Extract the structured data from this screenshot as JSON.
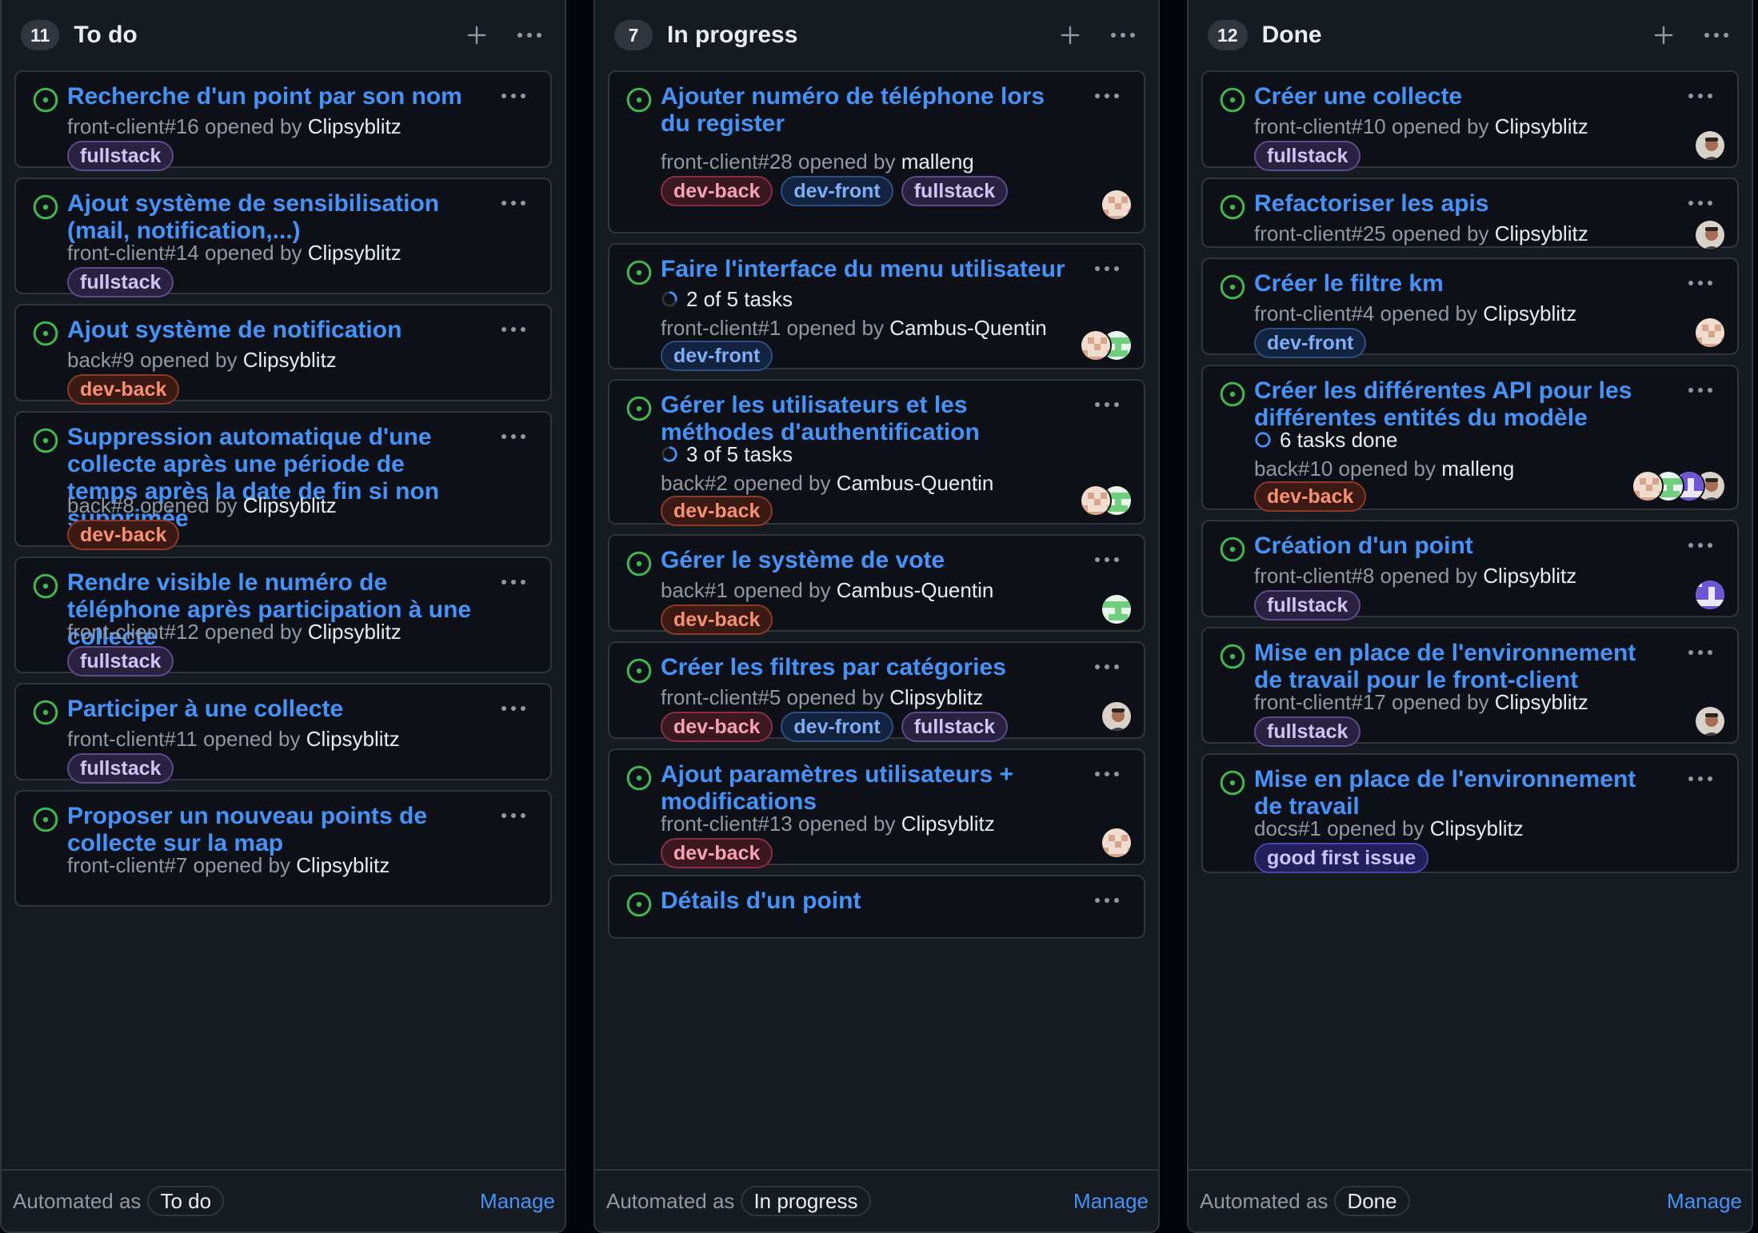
{
  "columns": [
    {
      "count": "11",
      "title": "To do",
      "footer": {
        "automated_label": "Automated as",
        "status": "To do",
        "manage": "Manage"
      },
      "cards": [
        {
          "title": "Recherche d'un point par son nom",
          "ref": "front-client#16",
          "opened_by": "opened by",
          "author": "Clipsyblitz",
          "labels": [
            {
              "text": "fullstack",
              "kind": "fullstack"
            }
          ],
          "avatars": []
        },
        {
          "title": "Ajout système de sensibilisation (mail, notification,...)",
          "ref": "front-client#14",
          "opened_by": "opened by",
          "author": "Clipsyblitz",
          "labels": [
            {
              "text": "fullstack",
              "kind": "fullstack"
            }
          ],
          "avatars": []
        },
        {
          "title": "Ajout système de notification",
          "ref": "back#9",
          "opened_by": "opened by",
          "author": "Clipsyblitz",
          "labels": [
            {
              "text": "dev-back",
              "kind": "devback"
            }
          ],
          "avatars": []
        },
        {
          "title": "Suppression automatique d'une collecte après une période de temps après la date de fin si non supprimée",
          "ref": "back#8",
          "opened_by": "opened by",
          "author": "Clipsyblitz",
          "labels": [
            {
              "text": "dev-back",
              "kind": "devback"
            }
          ],
          "avatars": []
        },
        {
          "title": "Rendre visible le numéro de téléphone après participation à une collecte",
          "ref": "front-client#12",
          "opened_by": "opened by",
          "author": "Clipsyblitz",
          "labels": [
            {
              "text": "fullstack",
              "kind": "fullstack"
            }
          ],
          "avatars": []
        },
        {
          "title": "Participer à une collecte",
          "ref": "front-client#11",
          "opened_by": "opened by",
          "author": "Clipsyblitz",
          "labels": [
            {
              "text": "fullstack",
              "kind": "fullstack"
            }
          ],
          "avatars": []
        },
        {
          "title": "Proposer un nouveau points de collecte sur la map",
          "ref": "front-client#7",
          "opened_by": "opened by",
          "author": "Clipsyblitz",
          "labels": [],
          "avatars": []
        }
      ]
    },
    {
      "count": "7",
      "title": "In progress",
      "footer": {
        "automated_label": "Automated as",
        "status": "In progress",
        "manage": "Manage"
      },
      "cards": [
        {
          "title": "Ajouter numéro de téléphone lors du register",
          "ref": "front-client#28",
          "opened_by": "opened by",
          "author": "malleng",
          "labels": [
            {
              "text": "dev-back",
              "kind": "devback-alt"
            },
            {
              "text": "dev-front",
              "kind": "devfront"
            },
            {
              "text": "fullstack",
              "kind": "fullstack"
            }
          ],
          "avatars": [
            "identicon-beige"
          ]
        },
        {
          "title": "Faire l'interface du menu utilisateur",
          "tasks": "2 of 5 tasks",
          "ref": "front-client#1",
          "opened_by": "opened by",
          "author": "Cambus-Quentin",
          "labels": [
            {
              "text": "dev-front",
              "kind": "devfront"
            }
          ],
          "avatars": [
            "identicon-beige",
            "identicon-green"
          ]
        },
        {
          "title": "Gérer les utilisateurs et les méthodes d'authentification",
          "tasks": "3 of 5 tasks",
          "ref": "back#2",
          "opened_by": "opened by",
          "author": "Cambus-Quentin",
          "labels": [
            {
              "text": "dev-back",
              "kind": "devback"
            }
          ],
          "avatars": [
            "identicon-beige",
            "identicon-green"
          ]
        },
        {
          "title": "Gérer le système de vote",
          "ref": "back#1",
          "opened_by": "opened by",
          "author": "Cambus-Quentin",
          "labels": [
            {
              "text": "dev-back",
              "kind": "devback"
            }
          ],
          "avatars": [
            "identicon-green"
          ]
        },
        {
          "title": "Créer les filtres par catégories",
          "ref": "front-client#5",
          "opened_by": "opened by",
          "author": "Clipsyblitz",
          "labels": [
            {
              "text": "dev-back",
              "kind": "devback-alt"
            },
            {
              "text": "dev-front",
              "kind": "devfront"
            },
            {
              "text": "fullstack",
              "kind": "fullstack"
            }
          ],
          "avatars": [
            "photo"
          ]
        },
        {
          "title": "Ajout paramètres utilisateurs + modifications",
          "ref": "front-client#13",
          "opened_by": "opened by",
          "author": "Clipsyblitz",
          "labels": [
            {
              "text": "dev-back",
              "kind": "devback-alt"
            }
          ],
          "avatars": [
            "identicon-beige"
          ]
        },
        {
          "title": "Détails d'un point",
          "ref": "",
          "opened_by": "",
          "author": "",
          "labels": [],
          "avatars": []
        }
      ]
    },
    {
      "count": "12",
      "title": "Done",
      "footer": {
        "automated_label": "Automated as",
        "status": "Done",
        "manage": "Manage"
      },
      "cards": [
        {
          "title": "Créer une collecte",
          "ref": "front-client#10",
          "opened_by": "opened by",
          "author": "Clipsyblitz",
          "labels": [
            {
              "text": "fullstack",
              "kind": "fullstack"
            }
          ],
          "avatars": [
            "photo"
          ]
        },
        {
          "title": "Refactoriser les apis",
          "ref": "front-client#25",
          "opened_by": "opened by",
          "author": "Clipsyblitz",
          "labels": [],
          "avatars": [
            "photo"
          ]
        },
        {
          "title": "Créer le filtre km",
          "ref": "front-client#4",
          "opened_by": "opened by",
          "author": "Clipsyblitz",
          "labels": [
            {
              "text": "dev-front",
              "kind": "devfront"
            }
          ],
          "avatars": [
            "identicon-beige"
          ]
        },
        {
          "title": "Créer les différentes API pour les différentes entités du modèle",
          "tasks": "6 tasks done",
          "tasks_done": true,
          "ref": "back#10",
          "opened_by": "opened by",
          "author": "malleng",
          "labels": [
            {
              "text": "dev-back",
              "kind": "devback"
            }
          ],
          "avatars": [
            "identicon-beige",
            "identicon-green",
            "identicon-purple",
            "photo"
          ]
        },
        {
          "title": "Création d'un point",
          "ref": "front-client#8",
          "opened_by": "opened by",
          "author": "Clipsyblitz",
          "labels": [
            {
              "text": "fullstack",
              "kind": "fullstack"
            }
          ],
          "avatars": [
            "identicon-purple"
          ]
        },
        {
          "title": "Mise en place de l'environnement de travail pour le front-client",
          "ref": "front-client#17",
          "opened_by": "opened by",
          "author": "Clipsyblitz",
          "labels": [
            {
              "text": "fullstack",
              "kind": "fullstack"
            }
          ],
          "avatars": [
            "photo"
          ]
        },
        {
          "title": "Mise en place de l'environnement de travail",
          "ref": "docs#1",
          "opened_by": "opened by",
          "author": "Clipsyblitz",
          "labels": [
            {
              "text": "good first issue",
              "kind": "gfi"
            }
          ],
          "avatars": []
        }
      ]
    }
  ],
  "icons": {
    "status": "issue-opened-icon",
    "add": "plus-icon",
    "menu": "kebab-horizontal-icon",
    "progress": "progress-circle-icon"
  },
  "colors": {
    "open": "#3fb950",
    "link": "#4493f8",
    "background": "#010409",
    "column": "#161b22",
    "card": "#0d1117"
  }
}
